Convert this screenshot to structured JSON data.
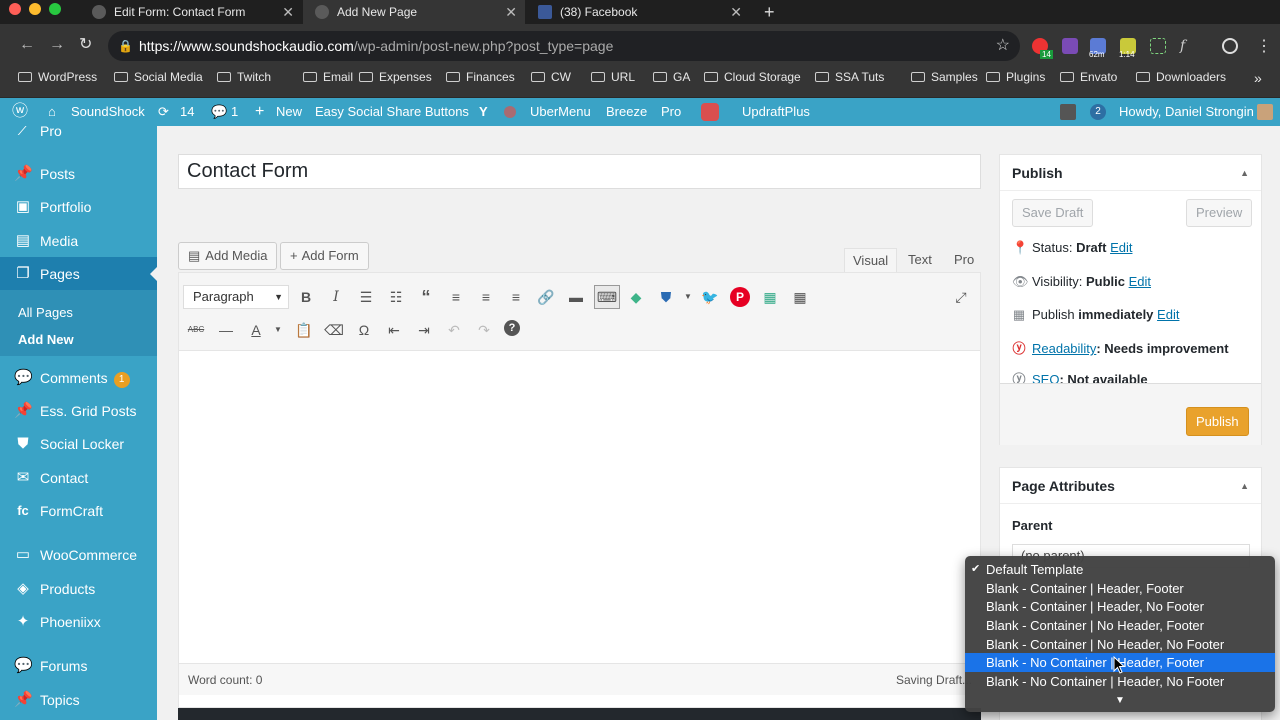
{
  "browser": {
    "tabs": [
      {
        "title": "Edit Form: Contact Form"
      },
      {
        "title": "Add New Page"
      },
      {
        "title": "(38) Facebook"
      }
    ],
    "url_domain": "https://www.soundshockaudio.com",
    "url_path": "/wp-admin/post-new.php?post_type=page",
    "bookmarks": [
      "WordPress",
      "Social Media",
      "Twitch",
      "Email",
      "Expenses",
      "Finances",
      "CW",
      "URL",
      "GA",
      "Cloud Storage",
      "SSA Tuts",
      "Samples",
      "Plugins",
      "Envato",
      "Downloaders"
    ],
    "more": "»",
    "ext_badges": {
      "first": "14",
      "second": "62m",
      "third": "1:14"
    }
  },
  "adminbar": {
    "site": "SoundShock",
    "updates": "14",
    "comments": "1",
    "new": "New",
    "items": [
      "Easy Social Share Buttons",
      "UberMenu",
      "Breeze",
      "Pro",
      "UpdraftPlus"
    ],
    "notif": "2",
    "howdy": "Howdy, Daniel Strongin"
  },
  "sidebar": {
    "partial": "Pro",
    "items": [
      {
        "label": "Posts"
      },
      {
        "label": "Portfolio"
      },
      {
        "label": "Media"
      },
      {
        "label": "Pages"
      },
      {
        "label": "Comments",
        "badge": "1"
      },
      {
        "label": "Ess. Grid Posts"
      },
      {
        "label": "Social Locker"
      },
      {
        "label": "Contact"
      },
      {
        "label": "FormCraft"
      },
      {
        "label": "WooCommerce"
      },
      {
        "label": "Products"
      },
      {
        "label": "Phoeniixx"
      },
      {
        "label": "Forums"
      },
      {
        "label": "Topics"
      }
    ],
    "submenu": [
      "All Pages",
      "Add New"
    ]
  },
  "editor": {
    "title": "Contact Form",
    "add_media": "Add Media",
    "add_form": "Add Form",
    "tabs": [
      "Visual",
      "Text",
      "Pro"
    ],
    "format": "Paragraph",
    "word_count": "Word count: 0",
    "saving": "Saving Draft..."
  },
  "publish": {
    "heading": "Publish",
    "save_draft": "Save Draft",
    "preview": "Preview",
    "status_label": "Status:",
    "status_value": "Draft",
    "visibility_label": "Visibility:",
    "visibility_value": "Public",
    "publish_label": "Publish",
    "publish_value": "immediately",
    "edit": "Edit",
    "readability_link": "Readability",
    "readability_value": ": Needs improvement",
    "seo_link": "SEO",
    "seo_value": ": Not available",
    "publish_button": "Publish"
  },
  "attributes": {
    "heading": "Page Attributes",
    "parent_label": "Parent",
    "parent_value": "(no parent)"
  },
  "template_dropdown": {
    "options": [
      "Default Template",
      "Blank - Container | Header, Footer",
      "Blank - Container | Header, No Footer",
      "Blank - Container | No Header, Footer",
      "Blank - Container | No Header, No Footer",
      "Blank - No Container | Header, Footer",
      "Blank - No Container | Header, No Footer"
    ],
    "checked_index": 0,
    "highlighted_index": 5,
    "scroll_more": "▼"
  },
  "colors": {
    "admin_blue": "#3aa3c6",
    "admin_blue_dark": "#1e7fae",
    "publish_orange": "#e9a22c",
    "dropdown_highlight": "#1a73e8"
  }
}
